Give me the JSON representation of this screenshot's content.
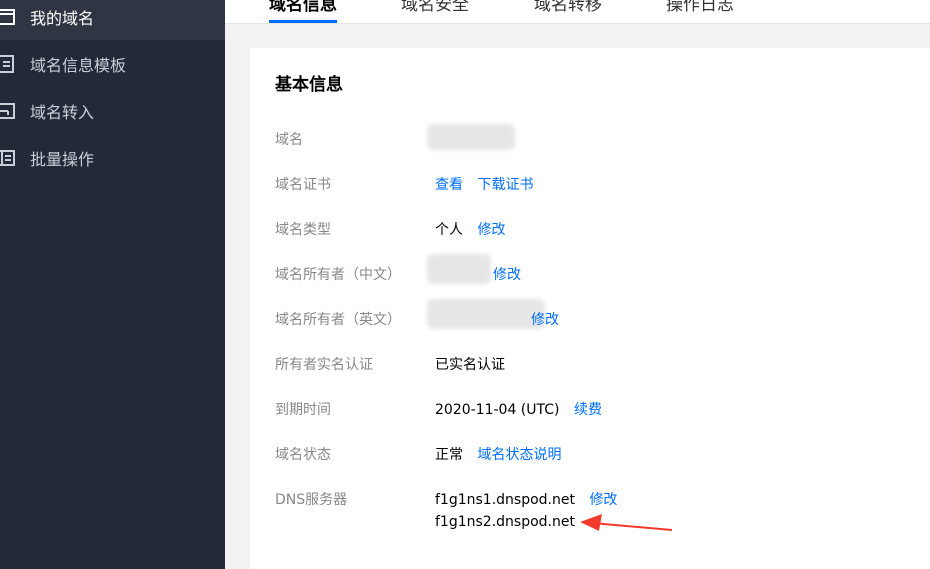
{
  "sidebar": {
    "items": [
      {
        "label": "我的域名",
        "icon": "browser-window-icon"
      },
      {
        "label": "域名信息模板",
        "icon": "document-icon"
      },
      {
        "label": "域名转入",
        "icon": "inbox-icon"
      },
      {
        "label": "批量操作",
        "icon": "list-icon"
      }
    ]
  },
  "tabs": [
    {
      "label": "域名信息"
    },
    {
      "label": "域名安全"
    },
    {
      "label": "域名转移"
    },
    {
      "label": "操作日志"
    }
  ],
  "card": {
    "title": "基本信息",
    "rows": {
      "domain": {
        "label": "域名"
      },
      "cert": {
        "label": "域名证书",
        "view": "查看",
        "download": "下载证书"
      },
      "type": {
        "label": "域名类型",
        "value": "个人",
        "edit": "修改"
      },
      "owner_cn": {
        "label": "域名所有者（中文）",
        "edit": "修改"
      },
      "owner_en": {
        "label": "域名所有者（英文）",
        "edit": "修改"
      },
      "verify": {
        "label": "所有者实名认证",
        "value": "已实名认证"
      },
      "expire": {
        "label": "到期时间",
        "value": "2020-11-04 (UTC)",
        "renew": "续费"
      },
      "status": {
        "label": "域名状态",
        "value": "正常",
        "help": "域名状态说明"
      },
      "dns": {
        "label": "DNS服务器",
        "ns1": "f1g1ns1.dnspod.net",
        "ns2": "f1g1ns2.dnspod.net",
        "edit": "修改"
      }
    }
  },
  "colors": {
    "link": "#006eff",
    "sidebar_bg": "#232936",
    "arrow": "#f03b2c"
  }
}
